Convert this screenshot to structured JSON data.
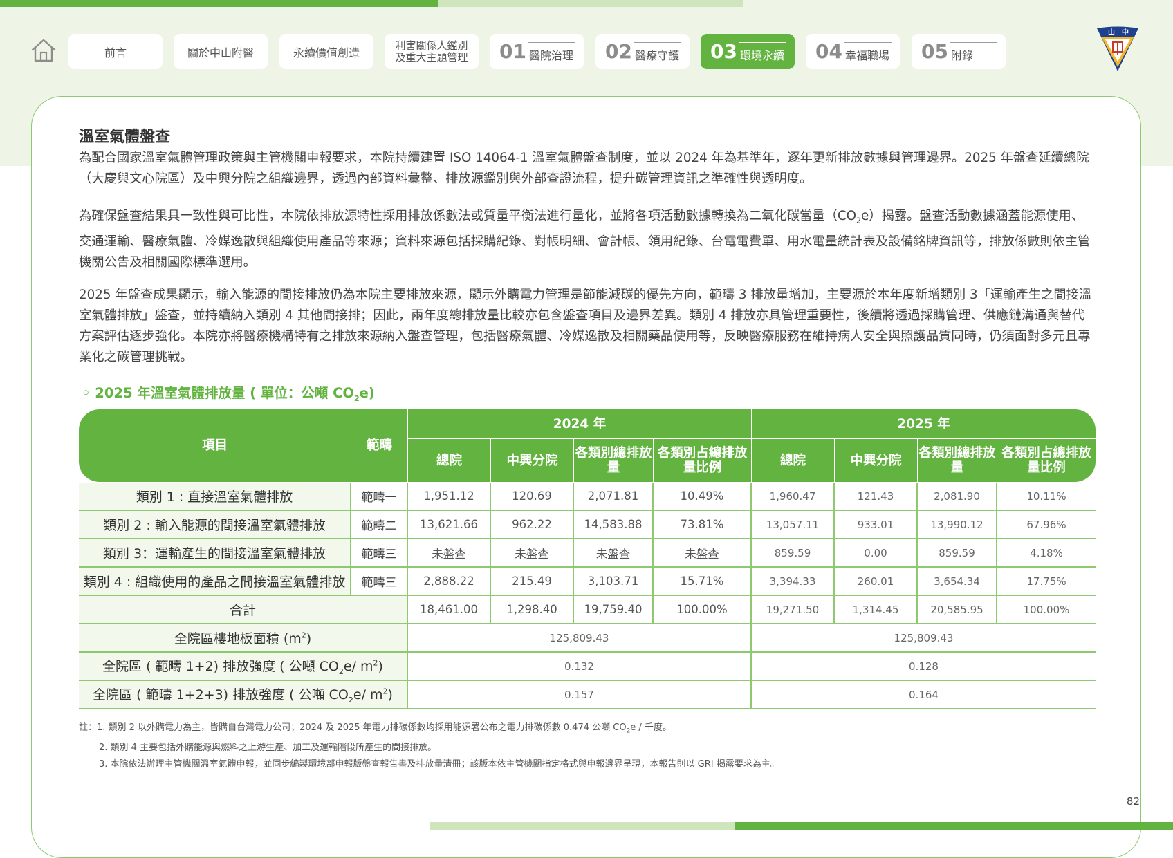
{
  "nav": {
    "items": [
      {
        "label": "前言"
      },
      {
        "label": "關於中山附醫"
      },
      {
        "label": "永續價值創造"
      },
      {
        "label_line1": "利害關係人鑑別",
        "label_line2": "及重大主題管理"
      },
      {
        "num": "01",
        "label": "醫院治理"
      },
      {
        "num": "02",
        "label": "醫療守護"
      },
      {
        "num": "03",
        "label": "環境永續",
        "active": true
      },
      {
        "num": "04",
        "label": "幸福職場"
      },
      {
        "num": "05",
        "label": "附錄"
      }
    ],
    "active_color": "#62b33f"
  },
  "logo": {
    "text": "山中醫"
  },
  "section": {
    "title": "溫室氣體盤查",
    "para1": "為配合國家溫室氣體管理政策與主管機關申報要求，本院持續建置 ISO 14064-1 溫室氣體盤查制度，並以 2024 年為基準年，逐年更新排放數據與管理邊界。2025 年盤查延續總院（大慶與文心院區）及中興分院之組織邊界，透過內部資料彙整、排放源鑑別與外部查證流程，提升碳管理資訊之準確性與透明度。",
    "para2_a": "為確保盤查結果具一致性與可比性，本院依排放源特性採用排放係數法或質量平衡法進行量化，並將各項活動數據轉換為二氧化碳當量（CO",
    "para2_sub": "2",
    "para2_b": "e）揭露。盤查活動數據涵蓋能源使用、交通運輸、醫療氣體、冷媒逸散與組織使用產品等來源；資料來源包括採購紀錄、對帳明細、會計帳、領用紀錄、台電電費單、用水電量統計表及設備銘牌資訊等，排放係數則依主管機關公告及相關國際標準選用。",
    "para3": "2025 年盤查成果顯示，輸入能源的間接排放仍為本院主要排放來源，顯示外購電力管理是節能減碳的優先方向，範疇 3 排放量增加，主要源於本年度新增類別 3「運輸產生之間接溫室氣體排放」盤查，並持續納入類別 4 其他間接排；因此，兩年度總排放量比較亦包含盤查項目及邊界差異。類別 4 排放亦具管理重要性，後續將透過採購管理、供應鏈溝通與替代方案評估逐步強化。本院亦將醫療機構特有之排放來源納入盤查管理，包括醫療氣體、冷媒逸散及相關藥品使用等，反映醫療服務在維持病人安全與照護品質同時，仍須面對多元且專業化之碳管理挑戰。"
  },
  "table": {
    "title_a": "◦  2025 年溫室氣體排放量 ( 單位：公噸 CO",
    "title_sub": "2",
    "title_b": "e)",
    "header": {
      "item": "項目",
      "scope": "範疇",
      "year1": "2024 年",
      "year2": "2025 年",
      "sub": [
        "總院",
        "中興分院",
        "各類別總排放量",
        "各類別占總排放量比例",
        "總院",
        "中興分院",
        "各類別總排放量",
        "各類別占總排放量比例"
      ]
    },
    "rows": [
      {
        "item": "類別 1 : 直接溫室氣體排放",
        "scope": "範疇一",
        "v": [
          "1,951.12",
          "120.69",
          "2,071.81",
          "10.49%",
          "1,960.47",
          "121.43",
          "2,081.90",
          "10.11%"
        ]
      },
      {
        "item": "類別 2 : 輸入能源的間接溫室氣體排放",
        "scope": "範疇二",
        "v": [
          "13,621.66",
          "962.22",
          "14,583.88",
          "73.81%",
          "13,057.11",
          "933.01",
          "13,990.12",
          "67.96%"
        ]
      },
      {
        "item": "類別 3：運輸產生的間接溫室氣體排放",
        "scope": "範疇三",
        "v": [
          "未盤查",
          "未盤查",
          "未盤查",
          "未盤查",
          "859.59",
          "0.00",
          "859.59",
          "4.18%"
        ]
      },
      {
        "item": "類別 4 : 組織使用的產品之間接溫室氣體排放",
        "scope": "範疇三",
        "v": [
          "2,888.22",
          "215.49",
          "3,103.71",
          "15.71%",
          "3,394.33",
          "260.01",
          "3,654.34",
          "17.75%"
        ]
      }
    ],
    "total": {
      "label": "合計",
      "v": [
        "18,461.00",
        "1,298.40",
        "19,759.40",
        "100.00%",
        "19,271.50",
        "1,314.45",
        "20,585.95",
        "100.00%"
      ]
    },
    "area": {
      "label": "全院區樓地板面積 (m",
      "label_sup": "2",
      "label_end": ")",
      "v2024": "125,809.43",
      "v2025": "125,809.43"
    },
    "intensity12": {
      "label": "全院區 ( 範疇 1+2) 排放強度 ( 公噸 CO",
      "sub": "2",
      "mid": "e/ m",
      "sup": "2",
      "end": ")",
      "v2024": "0.132",
      "v2025": "0.128"
    },
    "intensity123": {
      "label": "全院區 ( 範疇 1+2+3) 排放強度 ( 公噸 CO",
      "sub": "2",
      "mid": "e/ m",
      "sup": "2",
      "end": ")",
      "v2024": "0.157",
      "v2025": "0.164"
    }
  },
  "notes": {
    "n1_a": "註：1. 類別 2 以外購電力為主，皆購自台灣電力公司；2024 及 2025 年電力排碳係數均採用能源署公布之電力排碳係數 0.474 公噸 CO",
    "n1_sub": "2",
    "n1_b": "e / 千度。",
    "n2": "2. 類別 4 主要包括外購能源與燃料之上游生產、加工及運輸階段所產生的間接排放。",
    "n3": "3. 本院依法辦理主管機關溫室氣體申報，並同步編製環境部申報版盤查報告書及排放量清冊；該版本依主管機關指定格式與申報邊界呈現，本報告則以 GRI 揭露要求為主。"
  },
  "page_number": "82"
}
